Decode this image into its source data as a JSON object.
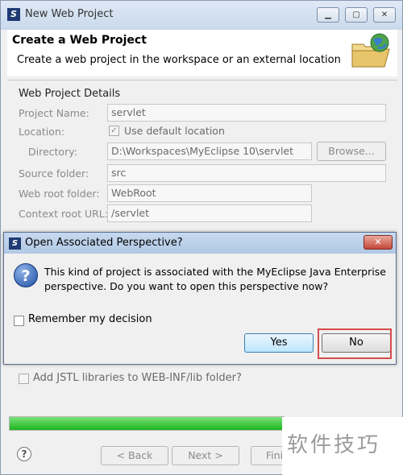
{
  "window": {
    "title": "New Web Project",
    "header_title": "Create a Web Project",
    "header_desc": "Create a web project in the workspace or an external location"
  },
  "details": {
    "group_title": "Web Project Details",
    "project_name_label": "Project Name:",
    "project_name_value": "servlet",
    "location_label": "Location:",
    "use_default_label": "Use default location",
    "directory_label": "Directory:",
    "directory_value": "D:\\Workspaces\\MyEclipse 10\\servlet",
    "browse_label": "Browse...",
    "source_folder_label": "Source folder:",
    "source_folder_value": "src",
    "web_root_label": "Web root folder:",
    "web_root_value": "WebRoot",
    "context_root_label": "Context root URL:",
    "context_root_value": "/servlet"
  },
  "jstl": {
    "label": "Add JSTL libraries to WEB-INF/lib folder?"
  },
  "dialog": {
    "title": "Open Associated Perspective?",
    "message_line1": "This kind of project is associated with the MyEclipse Java Enterprise",
    "message_line2": "perspective.  Do you want to open this perspective now?",
    "remember_label": "Remember my decision",
    "yes_label": "Yes",
    "no_label": "No"
  },
  "footer": {
    "back_label": "< Back",
    "next_label": "Next >",
    "finish_label": "Fini",
    "progress_fraction": 1.0,
    "progress_color": "#1db31d"
  },
  "watermark": "软件技巧"
}
